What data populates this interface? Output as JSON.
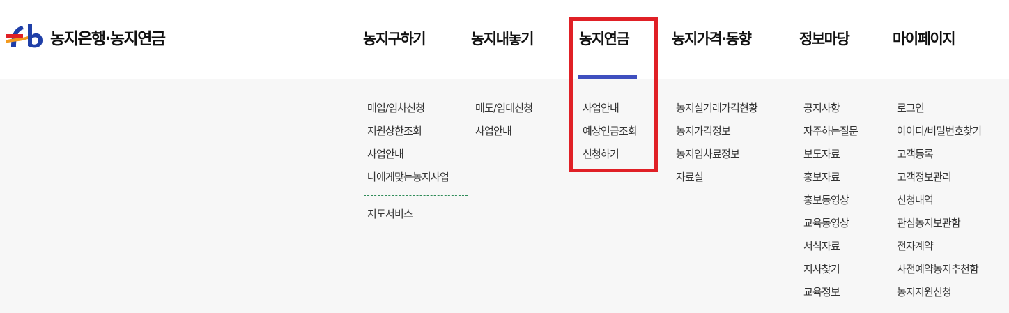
{
  "logo": {
    "mark": "Fb",
    "text": "농지은행·농지연금"
  },
  "nav": {
    "items": [
      {
        "label": "농지구하기"
      },
      {
        "label": "농지내놓기"
      },
      {
        "label": "농지연금",
        "active": true
      },
      {
        "label": "농지가격·동향"
      },
      {
        "label": "정보마당"
      },
      {
        "label": "마이페이지"
      }
    ]
  },
  "submenus": {
    "col1": [
      "매입/임차신청",
      "지원상한조회",
      "사업안내",
      "나에게맞는농지사업"
    ],
    "col1_extra": [
      "지도서비스"
    ],
    "col2": [
      "매도/임대신청",
      "사업안내"
    ],
    "col3": [
      "사업안내",
      "예상연금조회",
      "신청하기"
    ],
    "col4": [
      "농지실거래가격현황",
      "농지가격정보",
      "농지임차료정보",
      "자료실"
    ],
    "col5": [
      "공지사항",
      "자주하는질문",
      "보도자료",
      "홍보자료",
      "홍보동영상",
      "교육동영상",
      "서식자료",
      "지사찾기",
      "교육정보"
    ],
    "col6": [
      "로그인",
      "아이디/비밀번호찾기",
      "고객등록",
      "고객정보관리",
      "신청내역",
      "관심농지보관함",
      "전자계약",
      "사전예약농지추천함",
      "농지지원신청"
    ]
  },
  "colors": {
    "active_underline": "#3f4fbf",
    "highlight_box": "#e02026",
    "divider": "#2e8b57",
    "logo_blue": "#1f3fa8",
    "logo_red": "#e02026",
    "logo_orange": "#f39a1e"
  }
}
